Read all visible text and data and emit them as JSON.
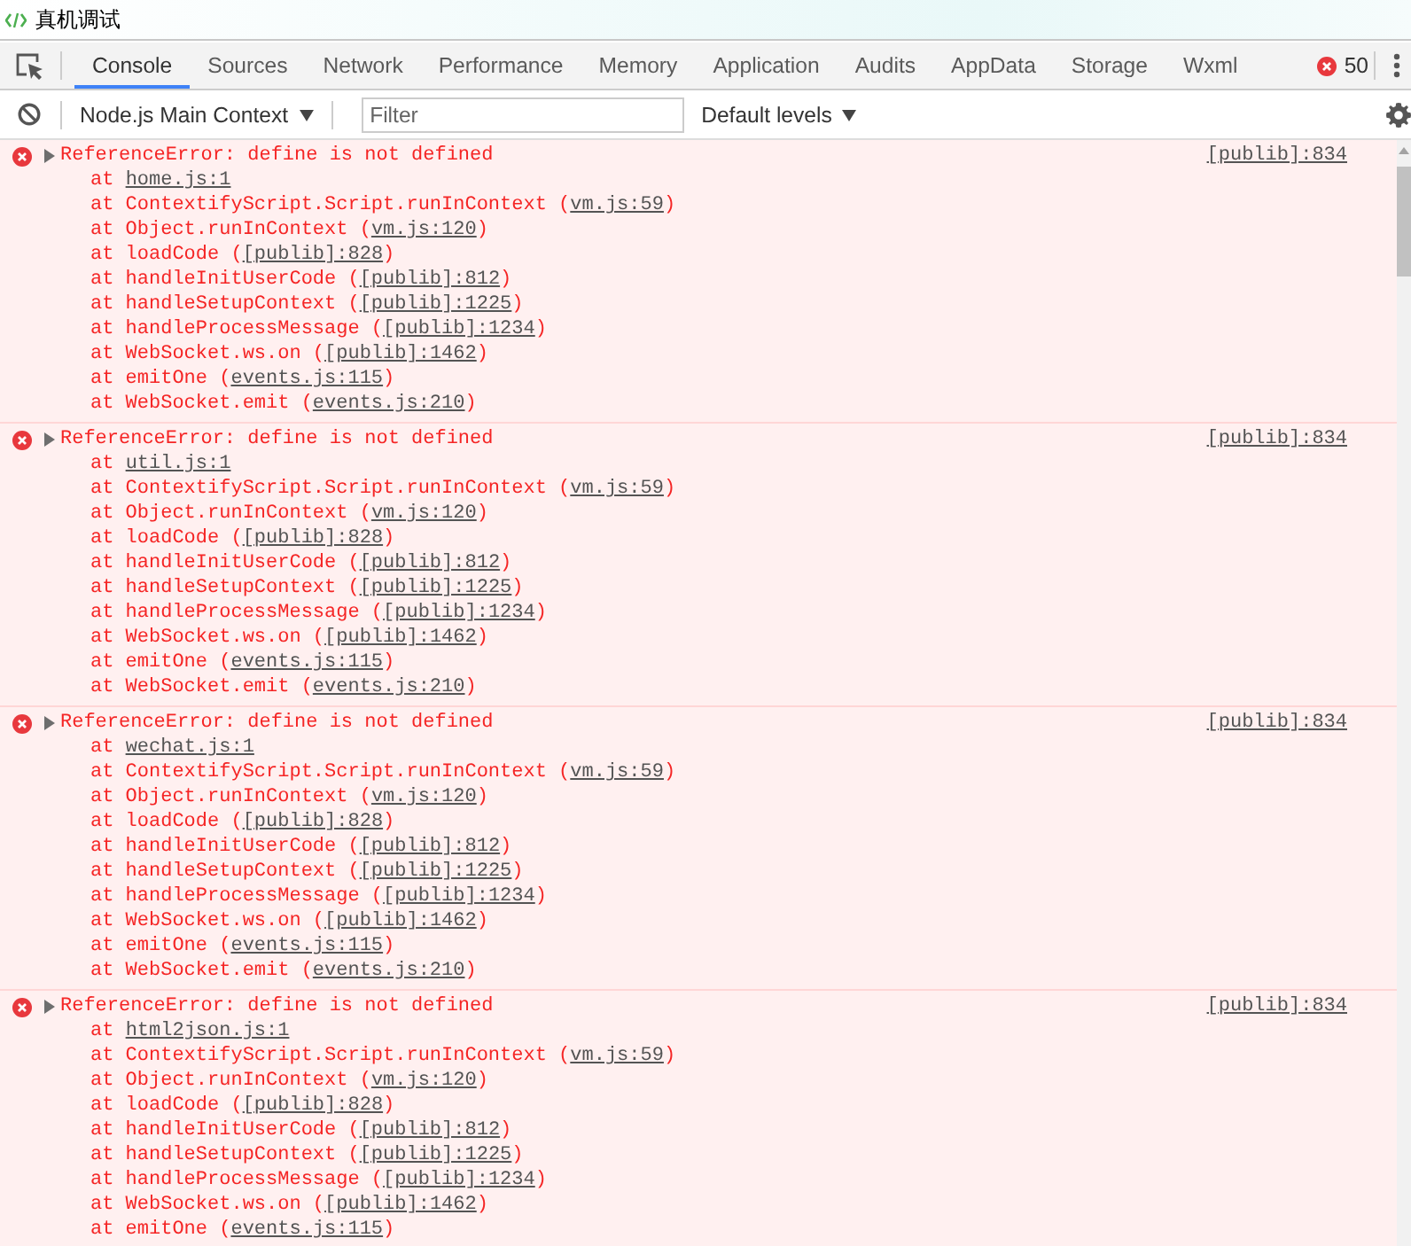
{
  "window": {
    "title": "真机调试"
  },
  "tabs": [
    {
      "label": "Console",
      "selected": true
    },
    {
      "label": "Sources",
      "selected": false
    },
    {
      "label": "Network",
      "selected": false
    },
    {
      "label": "Performance",
      "selected": false
    },
    {
      "label": "Memory",
      "selected": false
    },
    {
      "label": "Application",
      "selected": false
    },
    {
      "label": "Audits",
      "selected": false
    },
    {
      "label": "AppData",
      "selected": false
    },
    {
      "label": "Storage",
      "selected": false
    },
    {
      "label": "Wxml",
      "selected": false
    }
  ],
  "error_count": "50",
  "toolbar": {
    "context": "Node.js Main Context",
    "filter": {
      "placeholder": "Filter"
    },
    "levels": "Default levels"
  },
  "messages": [
    {
      "kind": "error",
      "text": "ReferenceError: define is not defined",
      "source": "[publib]:834",
      "frames": [
        {
          "before": "at ",
          "link": "home.js:1"
        },
        {
          "before": "at ContextifyScript.Script.runInContext (",
          "link": "vm.js:59",
          "after": ")"
        },
        {
          "before": "at Object.runInContext (",
          "link": "vm.js:120",
          "after": ")"
        },
        {
          "before": "at loadCode (",
          "link": "[publib]:828",
          "after": ")"
        },
        {
          "before": "at handleInitUserCode (",
          "link": "[publib]:812",
          "after": ")"
        },
        {
          "before": "at handleSetupContext (",
          "link": "[publib]:1225",
          "after": ")"
        },
        {
          "before": "at handleProcessMessage (",
          "link": "[publib]:1234",
          "after": ")"
        },
        {
          "before": "at WebSocket.ws.on (",
          "link": "[publib]:1462",
          "after": ")"
        },
        {
          "before": "at emitOne (",
          "link": "events.js:115",
          "after": ")"
        },
        {
          "before": "at WebSocket.emit (",
          "link": "events.js:210",
          "after": ")"
        }
      ]
    },
    {
      "kind": "error",
      "text": "ReferenceError: define is not defined",
      "source": "[publib]:834",
      "frames": [
        {
          "before": "at ",
          "link": "util.js:1"
        },
        {
          "before": "at ContextifyScript.Script.runInContext (",
          "link": "vm.js:59",
          "after": ")"
        },
        {
          "before": "at Object.runInContext (",
          "link": "vm.js:120",
          "after": ")"
        },
        {
          "before": "at loadCode (",
          "link": "[publib]:828",
          "after": ")"
        },
        {
          "before": "at handleInitUserCode (",
          "link": "[publib]:812",
          "after": ")"
        },
        {
          "before": "at handleSetupContext (",
          "link": "[publib]:1225",
          "after": ")"
        },
        {
          "before": "at handleProcessMessage (",
          "link": "[publib]:1234",
          "after": ")"
        },
        {
          "before": "at WebSocket.ws.on (",
          "link": "[publib]:1462",
          "after": ")"
        },
        {
          "before": "at emitOne (",
          "link": "events.js:115",
          "after": ")"
        },
        {
          "before": "at WebSocket.emit (",
          "link": "events.js:210",
          "after": ")"
        }
      ]
    },
    {
      "kind": "error",
      "text": "ReferenceError: define is not defined",
      "source": "[publib]:834",
      "frames": [
        {
          "before": "at ",
          "link": "wechat.js:1"
        },
        {
          "before": "at ContextifyScript.Script.runInContext (",
          "link": "vm.js:59",
          "after": ")"
        },
        {
          "before": "at Object.runInContext (",
          "link": "vm.js:120",
          "after": ")"
        },
        {
          "before": "at loadCode (",
          "link": "[publib]:828",
          "after": ")"
        },
        {
          "before": "at handleInitUserCode (",
          "link": "[publib]:812",
          "after": ")"
        },
        {
          "before": "at handleSetupContext (",
          "link": "[publib]:1225",
          "after": ")"
        },
        {
          "before": "at handleProcessMessage (",
          "link": "[publib]:1234",
          "after": ")"
        },
        {
          "before": "at WebSocket.ws.on (",
          "link": "[publib]:1462",
          "after": ")"
        },
        {
          "before": "at emitOne (",
          "link": "events.js:115",
          "after": ")"
        },
        {
          "before": "at WebSocket.emit (",
          "link": "events.js:210",
          "after": ")"
        }
      ]
    },
    {
      "kind": "error",
      "text": "ReferenceError: define is not defined",
      "source": "[publib]:834",
      "frames": [
        {
          "before": "at ",
          "link": "html2json.js:1"
        },
        {
          "before": "at ContextifyScript.Script.runInContext (",
          "link": "vm.js:59",
          "after": ")"
        },
        {
          "before": "at Object.runInContext (",
          "link": "vm.js:120",
          "after": ")"
        },
        {
          "before": "at loadCode (",
          "link": "[publib]:828",
          "after": ")"
        },
        {
          "before": "at handleInitUserCode (",
          "link": "[publib]:812",
          "after": ")"
        },
        {
          "before": "at handleSetupContext (",
          "link": "[publib]:1225",
          "after": ")"
        },
        {
          "before": "at handleProcessMessage (",
          "link": "[publib]:1234",
          "after": ")"
        },
        {
          "before": "at WebSocket.ws.on (",
          "link": "[publib]:1462",
          "after": ")"
        },
        {
          "before": "at emitOne (",
          "link": "events.js:115",
          "after": ")"
        }
      ]
    }
  ]
}
